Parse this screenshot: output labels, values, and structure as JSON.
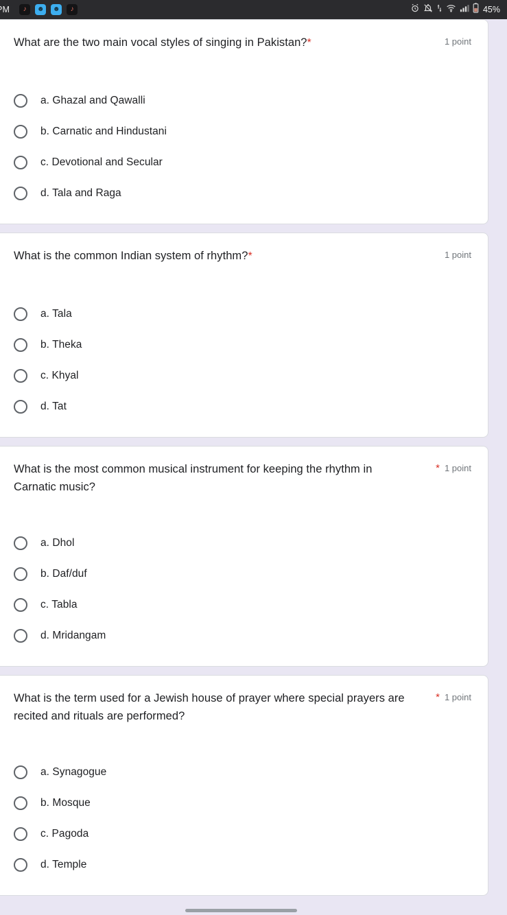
{
  "status_bar": {
    "time": "PM",
    "battery_percent": "45%",
    "notification_apps": [
      {
        "icon": "tiktok-notification-icon",
        "glyph": "♪",
        "style": "dark"
      },
      {
        "icon": "messenger-notification-icon",
        "glyph": "☻",
        "style": "blue"
      },
      {
        "icon": "messenger-notification-icon",
        "glyph": "☻",
        "style": "blue"
      },
      {
        "icon": "tiktok-notification-icon",
        "glyph": "♪",
        "style": "dark"
      }
    ],
    "system_icons": [
      "alarm-icon",
      "notifications-muted-icon",
      "data-transfer-icon",
      "wifi-icon",
      "signal-bars-icon",
      "battery-icon"
    ]
  },
  "form": {
    "points_label": "1 point",
    "required_marker": "*",
    "questions": [
      {
        "title": "What are the two main vocal styles of singing in Pakistan?",
        "required": true,
        "points": "1 point",
        "wraps": false,
        "options": [
          "a. Ghazal and Qawalli",
          "b. Carnatic and Hindustani",
          "c. Devotional and Secular",
          "d. Tala and Raga"
        ]
      },
      {
        "title": "What is the common Indian system of rhythm?",
        "required": true,
        "points": "1 point",
        "wraps": false,
        "options": [
          "a. Tala",
          "b. Theka",
          "c. Khyal",
          "d. Tat"
        ]
      },
      {
        "title": "What is the most common musical instrument for keeping the rhythm in Carnatic music?",
        "required": true,
        "points": "1 point",
        "wraps": true,
        "options": [
          "a. Dhol",
          "b. Daf/duf",
          "c. Tabla",
          "d. Mridangam"
        ]
      },
      {
        "title": "What is the term used for a Jewish house of prayer where special prayers are recited and rituals are performed?",
        "required": true,
        "points": "1 point",
        "wraps": true,
        "options": [
          "a. Synagogue",
          "b. Mosque",
          "c. Pagoda",
          "d. Temple"
        ]
      }
    ]
  },
  "colors": {
    "page_background": "#e9e6f3",
    "card_background": "#ffffff",
    "required_red": "#d93025",
    "text_primary": "#202124",
    "text_secondary": "#70757a",
    "status_bar": "#2b2b2e",
    "scrollbar_thumb": "#9aa0a6"
  }
}
